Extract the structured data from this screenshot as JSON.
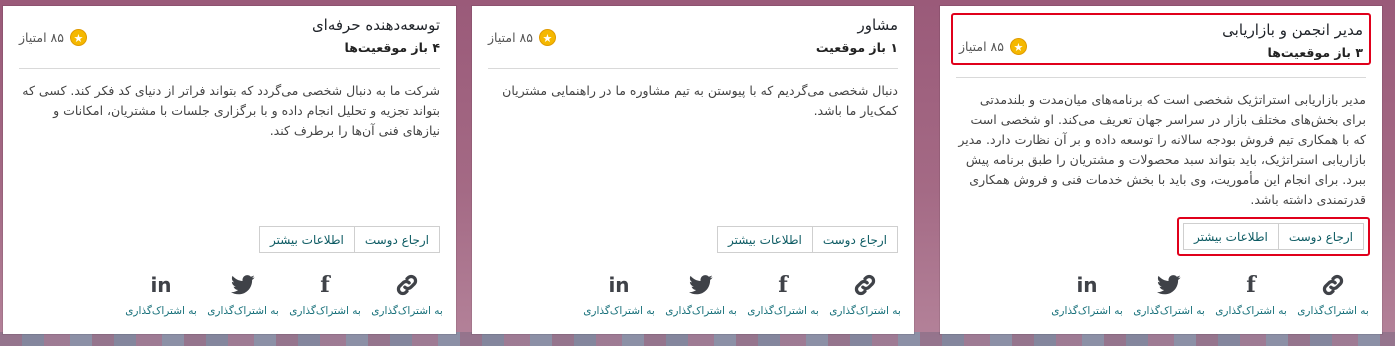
{
  "cards": [
    {
      "title": "مدیر انجمن و بازاریابی",
      "positions": "۳ باز موقعیت‌ها",
      "points": "۸۵ امتیاز",
      "description": "مدیر بازاریابی استراتژیک شخصی است که برنامه‌های میان‌مدت و بلندمدتی برای بخش‌های مختلف بازار در سراسر جهان تعریف می‌کند. او شخصی است که با همکاری تیم فروش بودجه سالانه را توسعه داده و بر آن نظارت دارد. مدیر بازاریابی استراتژیک، باید بتواند سبد محصولات و مشتریان را طبق برنامه پیش ببرد. برای انجام این مأموریت، وی باید با بخش خدمات فنی و فروش همکاری قدرتمندی داشته باشد.",
      "refer_label": "ارجاع دوست",
      "more_label": "اطلاعات بیشتر",
      "share_label": "به اشتراک‌گذاری"
    },
    {
      "title": "مشاور",
      "positions": "۱ باز موقعیت",
      "points": "۸۵ امتیاز",
      "description": "دنبال شخصی می‌گردیم که با پیوستن به تیم مشاوره ما در راهنمایی مشتریان کمک‌یار ما باشد.",
      "refer_label": "ارجاع دوست",
      "more_label": "اطلاعات بیشتر",
      "share_label": "به اشتراک‌گذاری"
    },
    {
      "title": "توسعه‌دهنده حرفه‌ای",
      "positions": "۴ باز موقعیت‌ها",
      "points": "۸۵ امتیاز",
      "description": "شرکت ما به دنبال شخصی می‌گردد که بتواند فراتر از دنیای کد فکر کند. کسی که بتواند تجزیه و تحلیل انجام داده و با برگزاری جلسات با مشتریان، امکانات و نیازهای فنی آن‌ها را برطرف کند.",
      "refer_label": "ارجاع دوست",
      "more_label": "اطلاعات بیشتر",
      "share_label": "به اشتراک‌گذاری"
    }
  ],
  "icons": [
    "link-icon",
    "facebook-icon",
    "twitter-icon",
    "linkedin-icon",
    "star-icon"
  ],
  "colors": {
    "highlight": "#e0001b",
    "link": "#17707a",
    "star": "#f5b800"
  }
}
